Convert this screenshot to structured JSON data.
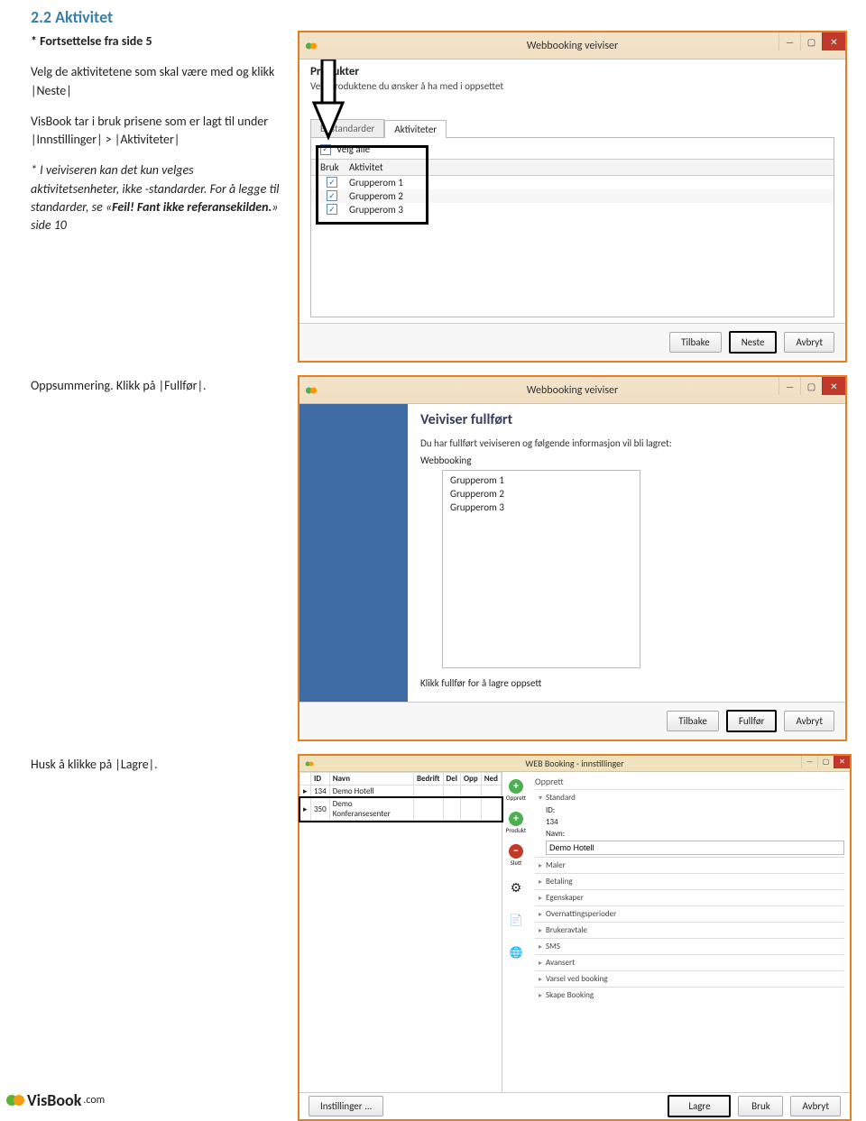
{
  "section_heading": "2.2 Aktivitet",
  "continuation": "* Fortsettelse fra side 5",
  "paragraph1": "Velg de aktivitetene som skal være med og klikk |Neste|",
  "paragraph2": "VisBook tar i bruk prisene som er lagt til under |Innstillinger| > |Aktiviteter|",
  "paragraph3": "* I veiviseren kan det kun velges aktivitetsenheter, ikke -standarder. For å legge til standarder, se «",
  "paragraph3_bold": "Feil! Fant ikke referansekilden.",
  "paragraph3_tail": "» side 10",
  "summary_line": "Oppsummering. Klikk på |Fullfør|.",
  "remember_line": "Husk å klikke på |Lagre|.",
  "win1": {
    "title": "Webbooking veiviser",
    "step_title": "Produkter",
    "desc": "Velg produktene du ønsker å ha med i oppsettet",
    "tab_standards": "Bostandarder",
    "tab_activities": "Aktiviteter",
    "select_all": "Velg alle",
    "col_use": "Bruk",
    "col_activity": "Aktivitet",
    "rows": [
      "Grupperom 1",
      "Grupperom 2",
      "Grupperom 3"
    ],
    "btn_back": "Tilbake",
    "btn_next": "Neste",
    "btn_cancel": "Avbryt"
  },
  "win2": {
    "title": "Webbooking veiviser",
    "done_title": "Veiviser fullført",
    "done_desc": "Du har fullført veiviseren og følgende informasjon vil bli lagret:",
    "subheading": "Webbooking",
    "items": [
      "Grupperom 1",
      "Grupperom 2",
      "Grupperom 3"
    ],
    "click_finish": "Klikk fullfør for å lagre oppsett",
    "btn_back": "Tilbake",
    "btn_finish": "Fullfør",
    "btn_cancel": "Avbryt"
  },
  "win3": {
    "title": "WEB Booking - innstillinger",
    "cols": [
      "ID",
      "Navn",
      "Bedrift",
      "Del",
      "Opp",
      "Ned"
    ],
    "rows": [
      {
        "id": "134",
        "name": "Demo Hotell"
      },
      {
        "id": "350",
        "name": "Demo Konferansesenter"
      }
    ],
    "tools": {
      "opprett": "Opprett",
      "produkt": "Produkt",
      "slett": "Slett"
    },
    "right": {
      "opprett": "Opprett",
      "standard": "Standard",
      "id_label": "ID:",
      "id_value": "134",
      "name_label": "Navn:",
      "name_value": "Demo Hotell",
      "sections": [
        "Maler",
        "Betaling",
        "Egenskaper",
        "Overnattingsperioder",
        "Brukeravtale",
        "SMS",
        "Avansert",
        "Varsel ved booking",
        "Skape Booking"
      ]
    },
    "footer": {
      "instillinger": "Instillinger ...",
      "lagre": "Lagre",
      "bruk": "Bruk",
      "avbryt": "Avbryt"
    }
  },
  "logo": {
    "brand": "VisBook",
    "tld": ".com"
  }
}
